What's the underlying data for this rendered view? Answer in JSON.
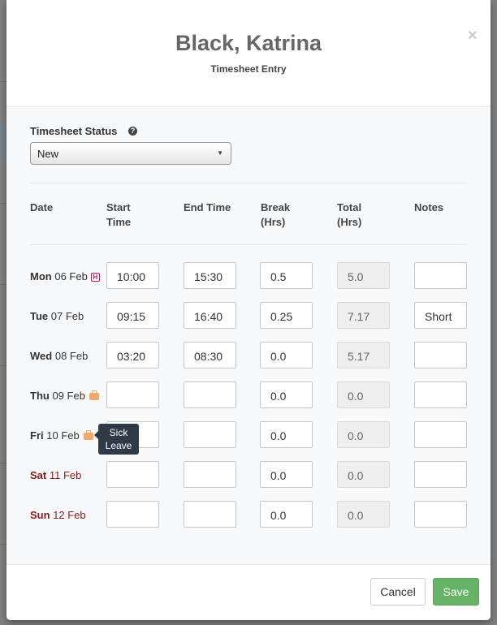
{
  "header": {
    "title": "Black, Katrina",
    "subtitle": "Timesheet Entry",
    "close_label": "×"
  },
  "status": {
    "label": "Timesheet Status",
    "help_icon": "?",
    "value": "New",
    "caret": "▼"
  },
  "columns": {
    "date": "Date",
    "start": "Start\nTime",
    "end": "End Time",
    "break": "Break\n(Hrs)",
    "total": "Total\n(Hrs)",
    "notes": "Notes"
  },
  "rows": [
    {
      "weekday": "Mon",
      "date": "06 Feb",
      "icon": "holiday-icon",
      "start": "10:00",
      "end": "15:30",
      "break": "0.5",
      "total": "5.0",
      "notes": ""
    },
    {
      "weekday": "Tue",
      "date": "07 Feb",
      "icon": "",
      "start": "09:15",
      "end": "16:40",
      "break": "0.25",
      "total": "7.17",
      "notes": "Short"
    },
    {
      "weekday": "Wed",
      "date": "08 Feb",
      "icon": "",
      "start": "03:20",
      "end": "08:30",
      "break": "0.0",
      "total": "5.17",
      "notes": ""
    },
    {
      "weekday": "Thu",
      "date": "09 Feb",
      "icon": "leave-bag-icon",
      "start": "",
      "end": "",
      "break": "0.0",
      "total": "0.0",
      "notes": ""
    },
    {
      "weekday": "Fri",
      "date": "10 Feb",
      "icon": "leave-bag-icon",
      "start": "",
      "end": "",
      "break": "0.0",
      "total": "0.0",
      "notes": ""
    },
    {
      "weekday": "Sat",
      "date": "11 Feb",
      "icon": "",
      "start": "",
      "end": "",
      "break": "0.0",
      "total": "0.0",
      "notes": ""
    },
    {
      "weekday": "Sun",
      "date": "12 Feb",
      "icon": "",
      "start": "",
      "end": "",
      "break": "0.0",
      "total": "0.0",
      "notes": ""
    }
  ],
  "tooltip": {
    "line1": "Sick",
    "line2": "Leave"
  },
  "footer": {
    "cancel_label": "Cancel",
    "save_label": "Save"
  },
  "colors": {
    "save_button": "#66b266",
    "weekend_text": "#8b1a1a",
    "holiday_icon": "#c2185b",
    "leave_icon": "#f2a86a"
  }
}
